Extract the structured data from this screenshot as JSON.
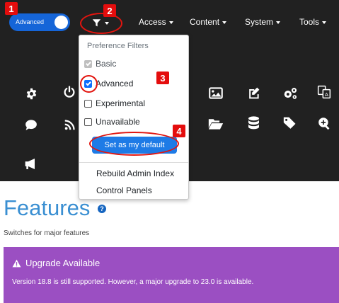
{
  "toggle": {
    "label": "Advanced",
    "state": "on"
  },
  "nav": {
    "items": [
      {
        "label": "Access"
      },
      {
        "label": "Content"
      },
      {
        "label": "System"
      },
      {
        "label": "Tools"
      }
    ]
  },
  "icons": [
    "gear-icon",
    "power-icon",
    "image-icon",
    "edit-icon",
    "gears-icon",
    "translate-icon",
    "comment-icon",
    "rss-icon",
    "folder-open-icon",
    "database-icon",
    "tags-icon",
    "search-plus-icon",
    "bullhorn-icon"
  ],
  "dropdown": {
    "header": "Preference Filters",
    "options": [
      {
        "label": "Basic",
        "state": "checked-disabled"
      },
      {
        "label": "Advanced",
        "state": "checked"
      },
      {
        "label": "Experimental",
        "state": "unchecked"
      },
      {
        "label": "Unavailable",
        "state": "unchecked"
      }
    ],
    "default_button": "Set as my default",
    "links": [
      {
        "label": "Rebuild Admin Index"
      },
      {
        "label": "Control Panels"
      }
    ]
  },
  "annotations": [
    "1",
    "2",
    "3",
    "4"
  ],
  "page": {
    "title": "Features",
    "subtitle": "Switches for major features"
  },
  "alert": {
    "title": "Upgrade Available",
    "text": "Version 18.8 is still supported. However, a major upgrade to 23.0 is available."
  },
  "colors": {
    "topbar": "#212121",
    "toggle": "#1565d8",
    "button": "#1e7be6",
    "annotation": "#e40d0d",
    "title": "#3a8fd2",
    "alert": "#9b4fc2"
  }
}
